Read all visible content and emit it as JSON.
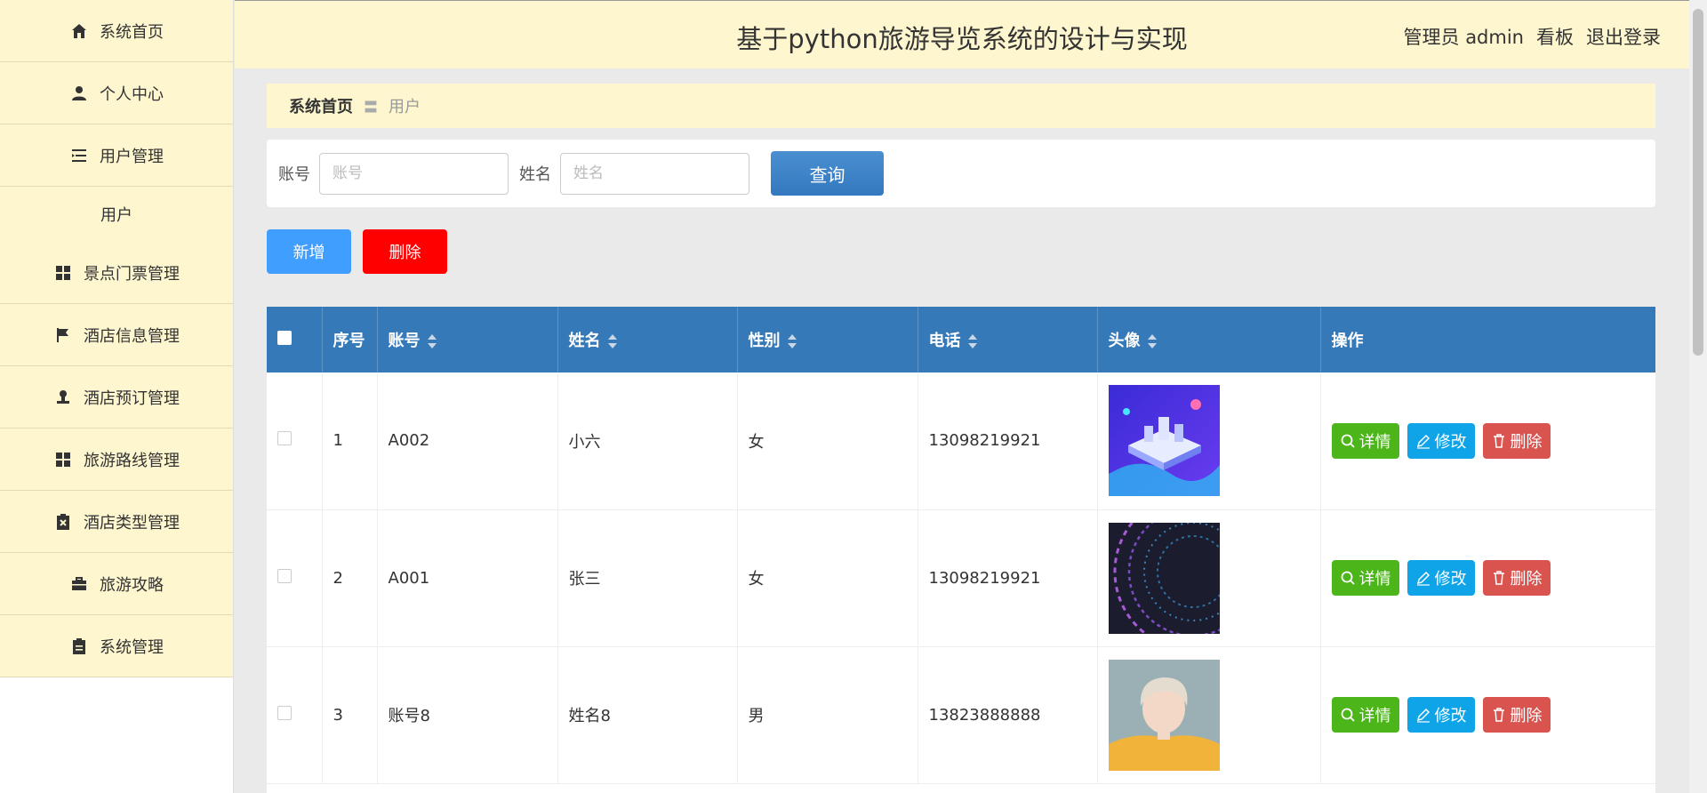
{
  "header": {
    "title": "基于python旅游导览系统的设计与实现",
    "user_label": "管理员 admin",
    "board_link": "看板",
    "logout_link": "退出登录"
  },
  "sidebar": {
    "items": [
      {
        "label": "系统首页",
        "icon": "home-icon"
      },
      {
        "label": "个人中心",
        "icon": "user-icon"
      },
      {
        "label": "用户管理",
        "icon": "list-icon"
      },
      {
        "label": "景点门票管理",
        "icon": "grid-icon"
      },
      {
        "label": "酒店信息管理",
        "icon": "flag-icon"
      },
      {
        "label": "酒店预订管理",
        "icon": "stamp-icon"
      },
      {
        "label": "旅游路线管理",
        "icon": "grid-icon"
      },
      {
        "label": "酒店类型管理",
        "icon": "clipboard-x-icon"
      },
      {
        "label": "旅游攻略",
        "icon": "briefcase-icon"
      },
      {
        "label": "系统管理",
        "icon": "clipboard-icon"
      }
    ],
    "sub_item": "用户"
  },
  "breadcrumb": {
    "home": "系统首页",
    "separator": "〓",
    "current": "用户"
  },
  "search": {
    "account_label": "账号",
    "account_placeholder": "账号",
    "name_label": "姓名",
    "name_placeholder": "姓名",
    "query_button": "查询"
  },
  "actions": {
    "add_button": "新增",
    "delete_button": "删除"
  },
  "table": {
    "columns": [
      "序号",
      "账号",
      "姓名",
      "性别",
      "电话",
      "头像",
      "操作"
    ],
    "rows": [
      {
        "index": "1",
        "account": "A002",
        "name": "小六",
        "gender": "女",
        "phone": "13098219921",
        "avatar": "isometric-city-image"
      },
      {
        "index": "2",
        "account": "A001",
        "name": "张三",
        "gender": "女",
        "phone": "13098219921",
        "avatar": "abstract-lines-image"
      },
      {
        "index": "3",
        "account": "账号8",
        "name": "姓名8",
        "gender": "男",
        "phone": "13823888888",
        "avatar": "person-photo-image"
      }
    ],
    "op_labels": {
      "detail": "详情",
      "edit": "修改",
      "delete": "删除"
    }
  },
  "colors": {
    "sidebar_bg": "#fdf6cf",
    "table_header": "#3579b8",
    "add": "#409eff",
    "delete": "#ff0000",
    "detail": "#4cb51a",
    "edit": "#0fa4e8",
    "row_delete": "#d9534f"
  }
}
